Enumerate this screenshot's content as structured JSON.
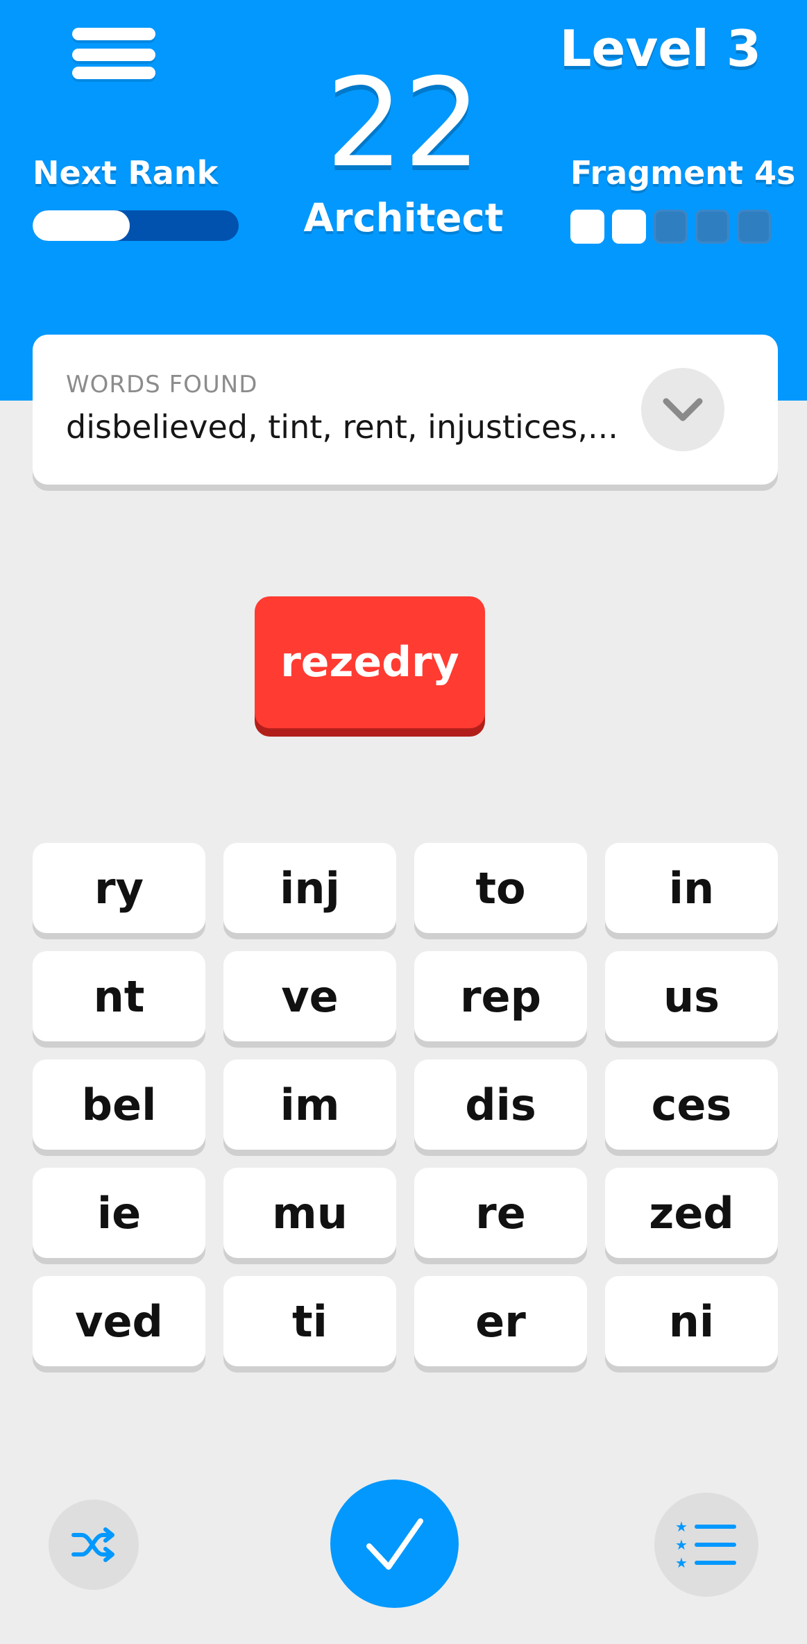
{
  "header": {
    "level": "Level 3",
    "score": "22",
    "rank": "Architect",
    "next_rank_label": "Next Rank",
    "next_rank_progress": 0.47,
    "fragment_label": "Fragment 4s",
    "fragment_filled": 2,
    "fragment_total": 5
  },
  "words_found": {
    "label": "WORDS FOUND",
    "list": "disbelieved, tint, rent, injustices,..."
  },
  "current_word": "rezedry",
  "tiles": [
    "ry",
    "inj",
    "to",
    "in",
    "nt",
    "ve",
    "rep",
    "us",
    "bel",
    "im",
    "dis",
    "ces",
    "ie",
    "mu",
    "re",
    "zed",
    "ved",
    "ti",
    "er",
    "ni"
  ],
  "colors": {
    "primary": "#0398fd",
    "current_word": "#ff3b32",
    "progress_track": "#0052ae"
  },
  "icons": {
    "menu": "hamburger-icon",
    "expand": "chevron-down-icon",
    "shuffle": "shuffle-icon",
    "submit": "checkmark-icon",
    "word_list": "star-list-icon"
  }
}
